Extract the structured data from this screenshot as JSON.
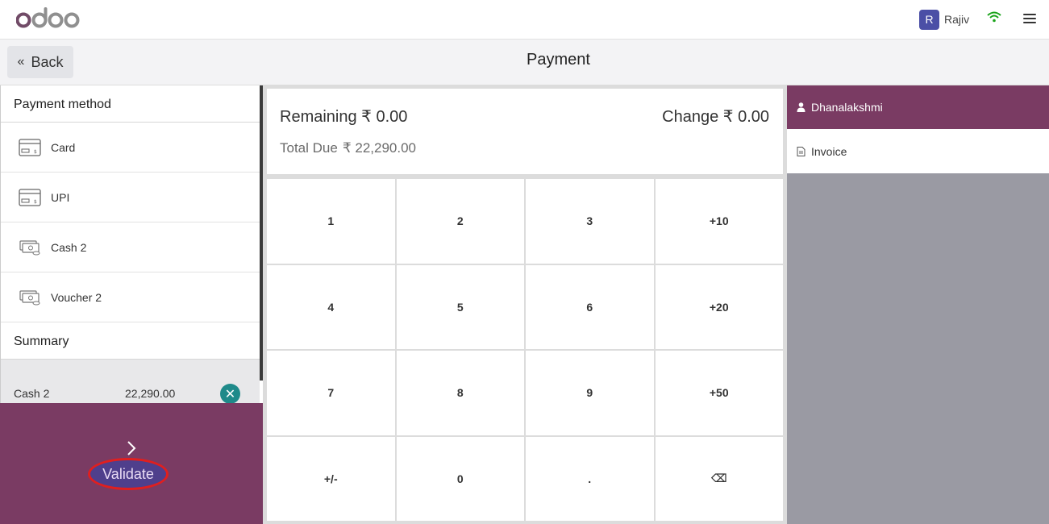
{
  "navbar": {
    "logo_text": "odoo",
    "user_initial": "R",
    "user_name": "Rajiv",
    "icons": [
      "wifi-icon",
      "hamburger-menu-icon"
    ]
  },
  "controlbar": {
    "back_label": "Back",
    "title": "Payment"
  },
  "left": {
    "payment_method_title": "Payment method",
    "methods": [
      {
        "label": "Card",
        "icon": "card-icon"
      },
      {
        "label": "UPI",
        "icon": "card-icon"
      },
      {
        "label": "Cash 2",
        "icon": "cash-icon"
      },
      {
        "label": "Voucher 2",
        "icon": "cash-icon"
      }
    ],
    "summary_title": "Summary",
    "summary_line": {
      "name": "Cash 2",
      "amount": "22,290.00"
    },
    "validate_label": "Validate"
  },
  "status": {
    "remaining": "Remaining ₹ 0.00",
    "change": "Change ₹ 0.00",
    "total_due_label": "Total Due",
    "total_due_value": "₹ 22,290.00"
  },
  "numpad": {
    "keys": [
      "1",
      "2",
      "3",
      "+10",
      "4",
      "5",
      "6",
      "+20",
      "7",
      "8",
      "9",
      "+50",
      "+/-",
      "0",
      ".",
      "⌫"
    ]
  },
  "right": {
    "customer": "Dhanalakshmi",
    "invoice": "Invoice"
  },
  "colors": {
    "brand_purple": "#7a3b63",
    "validate_highlight": "#e01f1f",
    "remove_button": "#1f8a8a",
    "avatar": "#4b4fa6"
  }
}
